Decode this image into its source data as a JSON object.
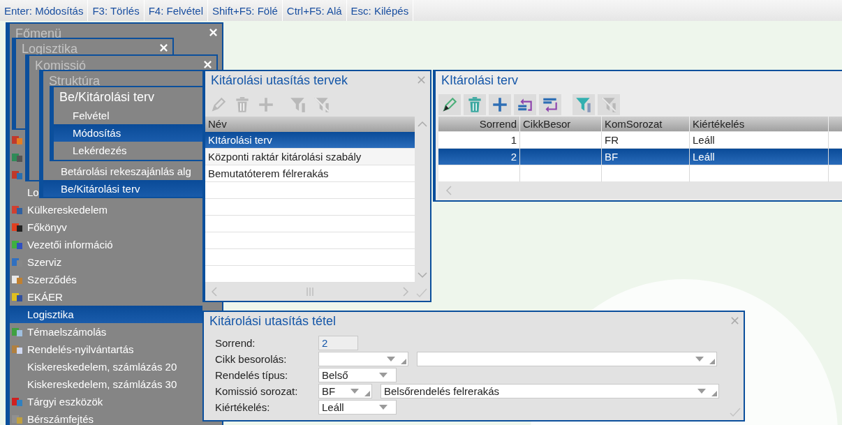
{
  "hotkeys": [
    "Enter: Módosítás",
    "F3: Törlés",
    "F4: Felvétel",
    "Shift+F5: Fölé",
    "Ctrl+F5: Alá",
    "Esc: Kilépés"
  ],
  "menus": [
    {
      "title": "Főmenü",
      "active": false,
      "closable": true,
      "items": [
        {
          "has_icon": true,
          "selected": false
        },
        {
          "has_icon": true,
          "selected": false
        },
        {
          "has_icon": true,
          "selected": false
        },
        {
          "label": "Lo",
          "has_icon": false,
          "selected": false
        },
        {
          "label": "Külkereskedelem",
          "has_icon": true,
          "selected": false
        },
        {
          "label": "Főkönyv",
          "has_icon": true,
          "selected": false
        },
        {
          "label": "Vezetői információ",
          "has_icon": true,
          "selected": false
        },
        {
          "label": "Szerviz",
          "has_icon": true,
          "selected": false
        },
        {
          "label": "Szerződés",
          "has_icon": true,
          "selected": false
        },
        {
          "label": "EKÁER",
          "has_icon": true,
          "selected": false
        },
        {
          "label": "Logisztika",
          "has_icon": false,
          "selected": true
        },
        {
          "label": "Témaelszámolás",
          "has_icon": true,
          "selected": false
        },
        {
          "label": "Rendelés-nyilvántartás",
          "has_icon": true,
          "selected": false
        },
        {
          "label": "Kiskereskedelem, számlázás 20",
          "has_icon": false,
          "selected": false
        },
        {
          "label": "Kiskereskedelem, számlázás 30",
          "has_icon": false,
          "selected": false
        },
        {
          "label": "Tárgyi eszközök",
          "has_icon": true,
          "selected": false
        },
        {
          "label": "Bérszámfejtés",
          "has_icon": true,
          "selected": false
        }
      ]
    },
    {
      "title": "Logisztika",
      "active": false,
      "closable": true
    },
    {
      "title": "Komissió",
      "active": false,
      "closable": true
    },
    {
      "title": "Struktúra",
      "active": false,
      "closable": false,
      "items": [
        {
          "label": "Betárolási rekeszajánlás alg",
          "selected": false
        },
        {
          "label": "Be/Kitárolási terv",
          "selected": true
        }
      ]
    },
    {
      "title": "Be/Kitárolási terv",
      "active": true,
      "closable": false,
      "items": [
        {
          "label": "Felvétel",
          "selected": false
        },
        {
          "label": "Módosítás",
          "selected": true
        },
        {
          "label": "Lekérdezés",
          "selected": false
        }
      ]
    }
  ],
  "plans_window": {
    "title": "Kitárolási utasítás tervek",
    "toolbar": [
      {
        "kind": "edit",
        "disabled": true
      },
      {
        "kind": "delete",
        "disabled": true
      },
      {
        "kind": "add",
        "disabled": true
      },
      {
        "kind": "filter",
        "disabled": true
      },
      {
        "kind": "clear_filter",
        "disabled": true
      }
    ],
    "column": "Név",
    "rows": [
      {
        "label": "KItárolási terv",
        "selected": true
      },
      {
        "label": "Központi raktár kitárolási szabály",
        "selected": false
      },
      {
        "label": "Bemutatóterem félrerakás",
        "selected": false
      }
    ]
  },
  "plan_window": {
    "title": "KItárolási terv",
    "toolbar": [
      {
        "kind": "edit",
        "disabled": false
      },
      {
        "kind": "delete",
        "disabled": false
      },
      {
        "kind": "add",
        "disabled": false
      },
      {
        "kind": "move_up",
        "disabled": false
      },
      {
        "kind": "move_down",
        "disabled": false
      },
      {
        "kind": "filter",
        "disabled": false
      },
      {
        "kind": "clear_filter",
        "disabled": true
      }
    ],
    "columns": [
      "Sorrend",
      "CikkBesor",
      "KomSorozat",
      "Kiértékelés"
    ],
    "rows": [
      {
        "cells": [
          "1",
          null,
          "FR",
          "Leáll"
        ],
        "selected": false
      },
      {
        "cells": [
          "2",
          null,
          "BF",
          "Leáll"
        ],
        "selected": true
      }
    ]
  },
  "form": {
    "title": "Kitárolási utasítás tétel",
    "rows": [
      {
        "label": "Sorrend:",
        "controls": [
          {
            "kind": "number",
            "value": "2"
          }
        ]
      },
      {
        "label": "Cikk besorolás:",
        "controls": [
          {
            "kind": "lookup"
          },
          {
            "kind": "lookup_wide"
          }
        ]
      },
      {
        "label": "Rendelés típus:",
        "controls": [
          {
            "kind": "select",
            "value": "Belső"
          }
        ]
      },
      {
        "label": "Komissió sorozat:",
        "controls": [
          {
            "kind": "code",
            "value": "BF"
          },
          {
            "kind": "lookup_long",
            "value": "Belsőrendelés felrerakás"
          }
        ]
      },
      {
        "label": "Kiértékelés:",
        "controls": [
          {
            "kind": "select",
            "value": "Leáll"
          }
        ]
      }
    ]
  }
}
